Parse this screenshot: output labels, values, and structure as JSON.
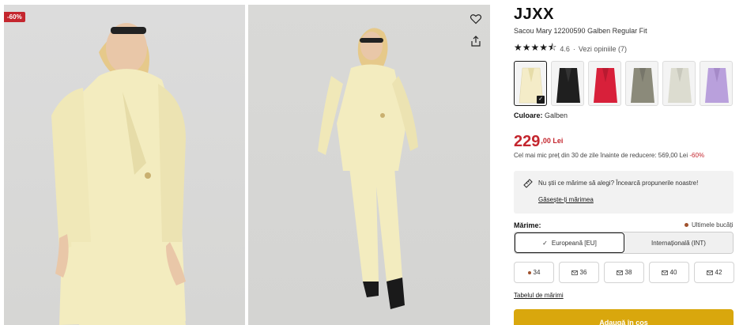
{
  "gallery": {
    "discount_badge": "-60%",
    "favorite_icon": "heart-icon",
    "share_icon": "share-icon"
  },
  "product": {
    "brand": "JJXX",
    "name": "Sacou Mary 12200590 Galben Regular Fit",
    "rating_value": "4.6",
    "rating_stars": 4.5,
    "reviews_link": "Vezi opiniile (7)",
    "color_label": "Culoare:",
    "color_value": "Galben"
  },
  "swatches": [
    {
      "color": "#f4ecc8",
      "selected": true
    },
    {
      "color": "#1f1f1f",
      "selected": false
    },
    {
      "color": "#d8203a",
      "selected": false
    },
    {
      "color": "#8b8a7a",
      "selected": false
    },
    {
      "color": "#dcdcd0",
      "selected": false
    },
    {
      "color": "#b9a0dc",
      "selected": false
    }
  ],
  "price": {
    "main": "229",
    "decimal": ",00 Lei",
    "note": "Cel mai mic preț din 30 de zile înainte de reducere: 569,00 Lei",
    "note_pct": "-60%"
  },
  "size_help": {
    "icon": "ruler-icon",
    "text": "Nu știi ce mărime să alegi? Încearcă propunerile noastre!",
    "link": "Găsește-ți mărimea"
  },
  "sizes": {
    "label": "Mărime:",
    "last_pieces": "Ultimele bucăți",
    "systems": [
      "Europeană [EU]",
      "Internațională (INT)"
    ],
    "options": [
      {
        "label": "34",
        "marker": "dot"
      },
      {
        "label": "36",
        "marker": "envelope"
      },
      {
        "label": "38",
        "marker": "envelope"
      },
      {
        "label": "40",
        "marker": "envelope"
      },
      {
        "label": "42",
        "marker": "envelope"
      }
    ],
    "table_link": "Tabelul de mărimi"
  },
  "cart": {
    "button_label": "Adaugă în coș"
  },
  "colors": {
    "accent_red": "#c4262e",
    "cart_yellow": "#d9a70d"
  }
}
